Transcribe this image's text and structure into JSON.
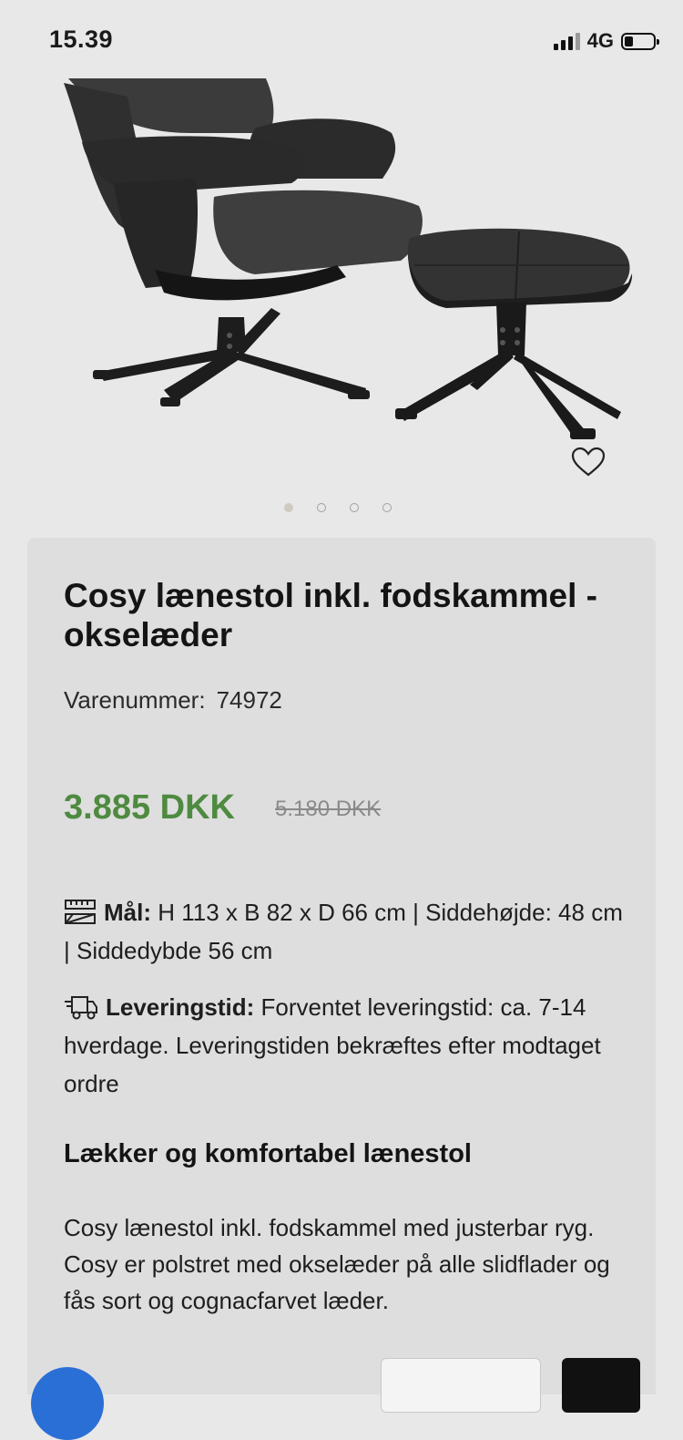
{
  "status_bar": {
    "time": "15.39",
    "network": "4G",
    "signal_bars": 3,
    "battery_level": 0.25
  },
  "gallery": {
    "slide_count": 4,
    "active_slide": 1
  },
  "product": {
    "title": "Cosy lænestol inkl. fodskammel - okselæder",
    "sku_label": "Varenummer:",
    "sku": "74972",
    "price": "3.885 DKK",
    "old_price": "5.180 DKK",
    "dimensions": {
      "icon": "ruler-icon",
      "label": "Mål:",
      "text": "H 113 x B 82 x D 66 cm | Siddehøjde: 48 cm | Siddedybde 56 cm"
    },
    "delivery": {
      "icon": "truck-icon",
      "label": "Leveringstid:",
      "text": "Forventet leveringstid: ca. 7-14 hverdage. Leveringstiden bekræftes efter modtaget ordre"
    },
    "section_heading": "Lækker og komfortabel lænestol",
    "description": [
      "Cosy lænestol inkl. fodskammel med justerbar ryg.",
      "Cosy er polstret med okselæder på alle slidflader og fås sort og cognacfarvet læder."
    ]
  },
  "colors": {
    "background": "#e8e8e8",
    "card": "#dedede",
    "price_green": "#4e8a40",
    "chat_blue": "#2a6fd6"
  }
}
